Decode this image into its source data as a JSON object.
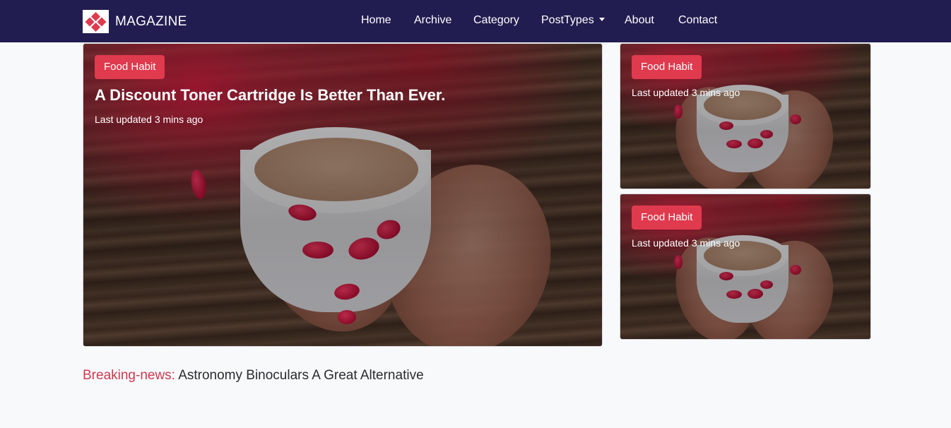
{
  "brand": {
    "name": "MAGAZINE",
    "logo_icon": "diamond-logo-icon",
    "logo_color": "#e03a4e"
  },
  "nav": {
    "items": [
      {
        "label": "Home"
      },
      {
        "label": "Archive"
      },
      {
        "label": "Category"
      },
      {
        "label": "PostTypes",
        "has_dropdown": true
      },
      {
        "label": "About"
      },
      {
        "label": "Contact"
      }
    ]
  },
  "featured": {
    "main": {
      "category": "Food Habit",
      "title": "A Discount Toner Cartridge Is Better Than Ever.",
      "updated": "Last updated 3 mins ago"
    },
    "side": [
      {
        "category": "Food Habit",
        "updated": "Last updated 3 mins ago"
      },
      {
        "category": "Food Habit",
        "updated": "Last updated 3 mins ago"
      }
    ]
  },
  "breaking": {
    "label": "Breaking-news:",
    "text": "Astronomy Binoculars A Great Alternative"
  },
  "colors": {
    "navbar": "#211d50",
    "accent": "#e03a4e",
    "background": "#f8f9fb"
  }
}
